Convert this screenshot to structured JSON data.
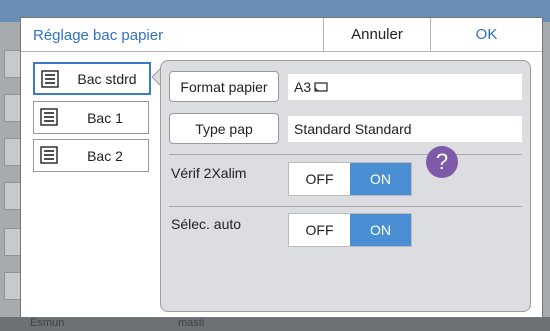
{
  "dialog": {
    "title": "Réglage bac papier",
    "cancel_label": "Annuler",
    "ok_label": "OK"
  },
  "trays": [
    {
      "label": "Bac stdrd",
      "selected": true
    },
    {
      "label": "Bac 1",
      "selected": false
    },
    {
      "label": "Bac 2",
      "selected": false
    }
  ],
  "settings": {
    "paper_format": {
      "button": "Format papier",
      "value": "A3"
    },
    "paper_type": {
      "button": "Type pap",
      "value": "Standard Standard"
    },
    "double_feed": {
      "label": "Vérif 2Xalim",
      "off": "OFF",
      "on": "ON",
      "selected": "ON",
      "help": "?"
    },
    "auto_select": {
      "label": "Sélec. auto",
      "off": "OFF",
      "on": "ON",
      "selected": "ON"
    }
  },
  "background": {
    "bottom_left": "Ésmun",
    "bottom_mid": "masti"
  },
  "colors": {
    "accent": "#2f72c2",
    "toggle_on": "#4a8fd3",
    "help": "#7e5aa8"
  }
}
